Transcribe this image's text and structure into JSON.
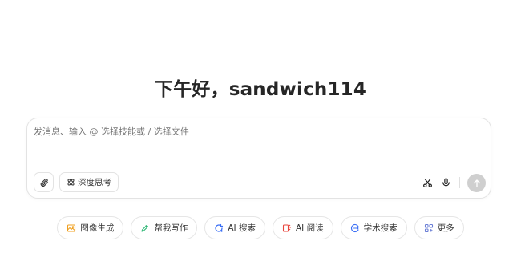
{
  "greeting": "下午好，sandwich114",
  "composer": {
    "placeholder": "发消息、输入 @ 选择技能或 / 选择文件",
    "deep_think_label": "深度思考"
  },
  "tools": [
    {
      "label": "图像生成",
      "icon": "image-gen-icon",
      "color": "#f0a020"
    },
    {
      "label": "帮我写作",
      "icon": "pen-icon",
      "color": "#2bb673"
    },
    {
      "label": "AI 搜索",
      "icon": "search-refresh-icon",
      "color": "#3b6ff5"
    },
    {
      "label": "AI 阅读",
      "icon": "book-icon",
      "color": "#e8453c"
    },
    {
      "label": "学术搜索",
      "icon": "graduation-icon",
      "color": "#3b6ff5"
    },
    {
      "label": "更多",
      "icon": "grid-more-icon",
      "color": "#6b7fd6"
    }
  ],
  "colors": {
    "send_button": "#cfcfcf",
    "border": "#e3e3e3"
  }
}
